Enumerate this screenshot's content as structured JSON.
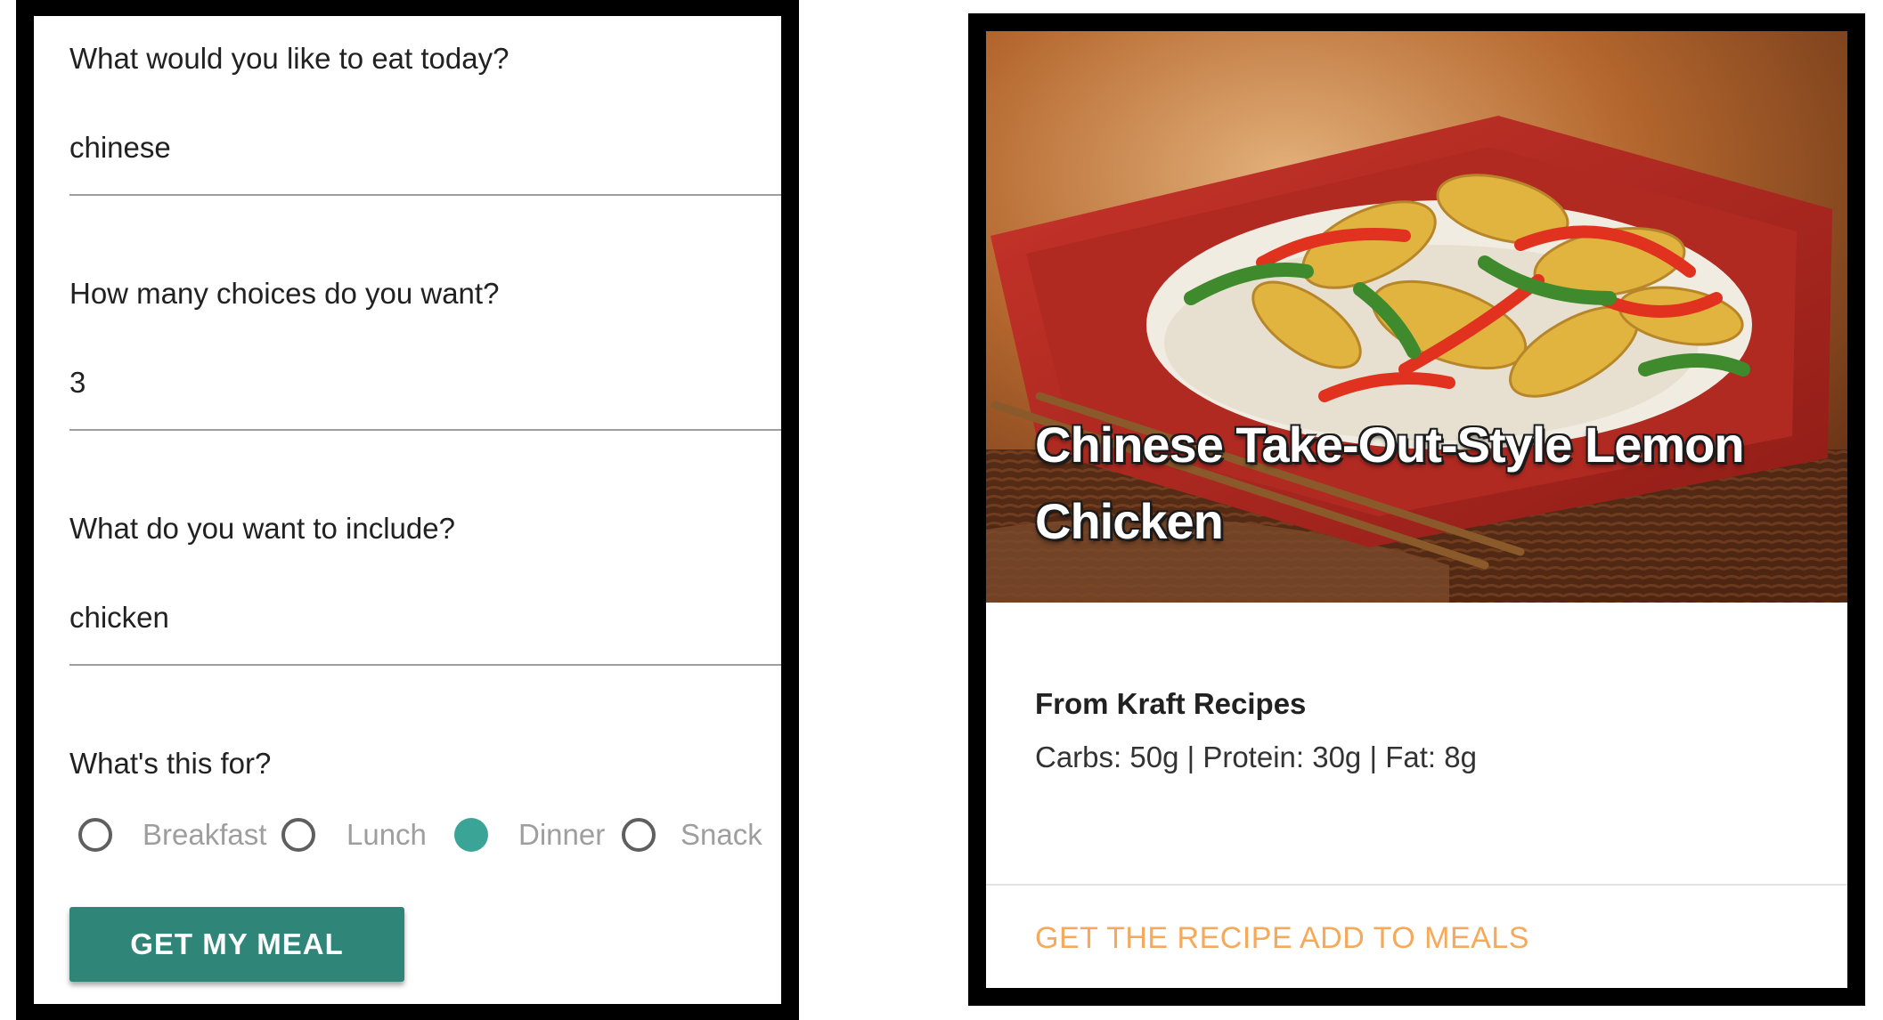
{
  "form": {
    "cuisine": {
      "label": "What would you like to eat today?",
      "value": "chinese"
    },
    "choices": {
      "label": "How many choices do you want?",
      "value": "3"
    },
    "include": {
      "label": "What do you want to include?",
      "value": "chicken"
    },
    "meal_type": {
      "label": "What's this for?",
      "options": [
        "Breakfast",
        "Lunch",
        "Dinner",
        "Snack"
      ],
      "selected": "Dinner"
    },
    "submit_label": "GET MY MEAL"
  },
  "card": {
    "title": "Chinese Take-Out-Style Lemon Chicken",
    "source": "From Kraft Recipes",
    "macros": "Carbs: 50g | Protein: 30g | Fat: 8g",
    "actions": {
      "recipe": "GET THE RECIPE",
      "add": "ADD TO MEALS"
    }
  },
  "colors": {
    "accent": "#3aa597",
    "button": "#2f8578",
    "action_text": "#f5a95a"
  }
}
